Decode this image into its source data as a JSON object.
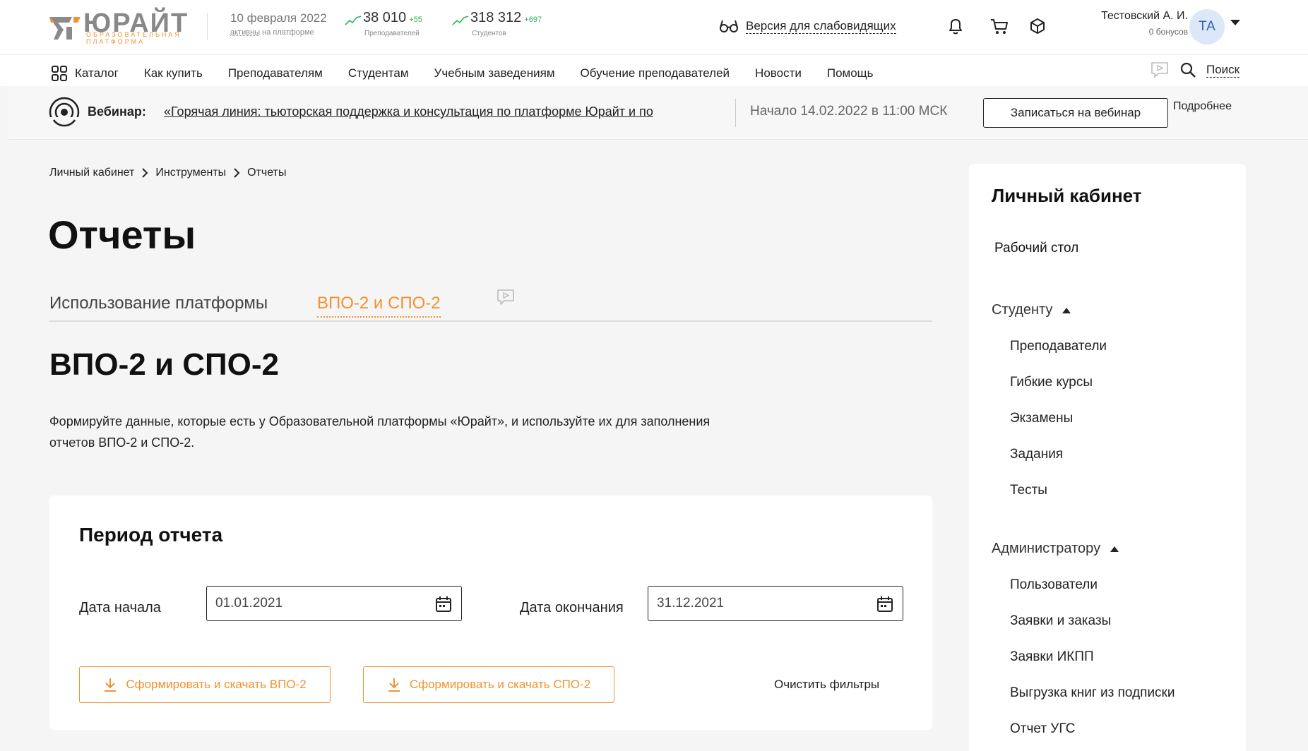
{
  "header": {
    "logo": {
      "word": "ЮРАЙТ",
      "sub": "ОБРАЗОВАТЕЛЬНАЯ ПЛАТФОРМА"
    },
    "date": {
      "value": "10 февраля 2022",
      "active_word": "активны",
      "active_rest": " на платформе"
    },
    "stats": [
      {
        "value": "38 010",
        "delta": "+55",
        "label": "Преподавателей"
      },
      {
        "value": "318 312",
        "delta": "+697",
        "label": "Студентов"
      }
    ],
    "accessibility_label": "Версия для слабовидящих",
    "user": {
      "name": "Тестовский А. И.",
      "bonus": "0 бонусов",
      "initials": "ТА"
    }
  },
  "nav": {
    "items": [
      "Каталог",
      "Как купить",
      "Преподавателям",
      "Студентам",
      "Учебным заведениям",
      "Обучение преподавателей",
      "Новости",
      "Помощь"
    ],
    "search_label": "Поиск"
  },
  "webinar": {
    "title": "Вебинар:",
    "link": "«Горячая линия: тьюторская поддержка и консультация по платформе Юрайт и по",
    "start": "Начало 14.02.2022 в 11:00 МСК",
    "register_button": "Записаться на вебинар",
    "more": "Подробнее"
  },
  "breadcrumb": [
    "Личный кабинет",
    "Инструменты",
    "Отчеты"
  ],
  "page": {
    "title": "Отчеты",
    "tabs": [
      "Использование платформы",
      "ВПО-2 и СПО-2"
    ],
    "section_title": "ВПО-2 и СПО-2",
    "description": "Формируйте данные, которые есть у Образовательной платформы «Юрайт», и используйте их для заполнения отчетов ВПО-2 и СПО-2."
  },
  "card": {
    "title": "Период отчета",
    "start_label": "Дата начала",
    "start_value": "01.01.2021",
    "end_label": "Дата окончания",
    "end_value": "31.12.2021",
    "btn_vpo": "Сформировать и скачать ВПО-2",
    "btn_spo": "Сформировать и скачать СПО-2",
    "clear": "Очистить фильтры"
  },
  "sidebar": {
    "title": "Личный кабинет",
    "top_item": "Рабочий стол",
    "groups": [
      {
        "label": "Студенту",
        "items": [
          "Преподаватели",
          "Гибкие курсы",
          "Экзамены",
          "Задания",
          "Тесты"
        ]
      },
      {
        "label": "Администратору",
        "items": [
          "Пользователи",
          "Заявки и заказы",
          "Заявки ИКПП",
          "Выгрузка книг из подписки",
          "Отчет УГС"
        ]
      }
    ]
  },
  "colors": {
    "accent": "#f29132",
    "positive": "#2db35d",
    "avatar_bg": "#dce7f8"
  }
}
